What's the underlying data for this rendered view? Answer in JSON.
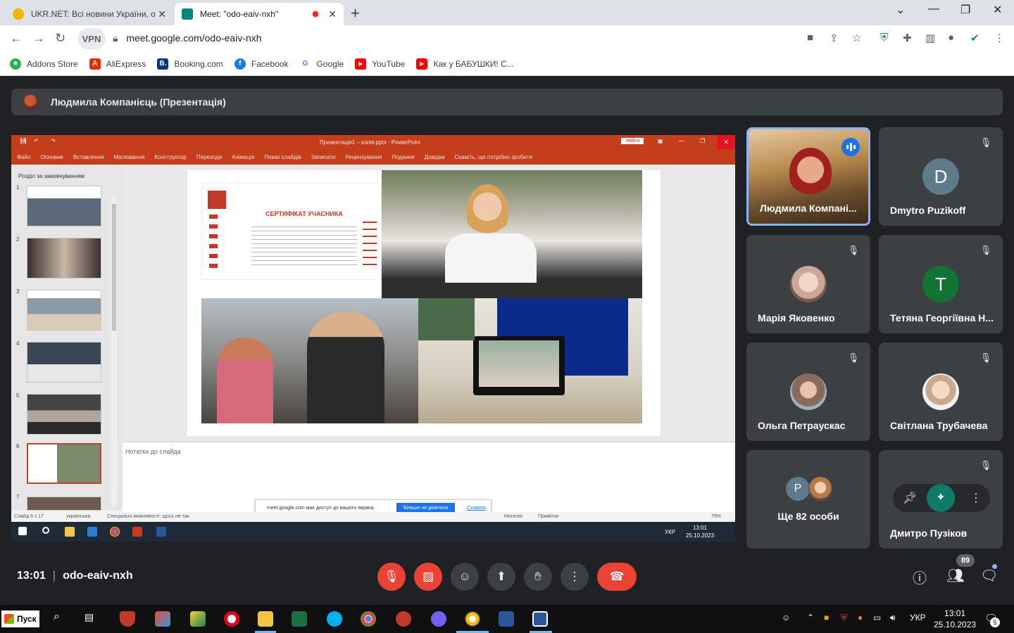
{
  "browser": {
    "tabs": [
      {
        "title": "UKR.NET: Всі новини України, о",
        "active": false,
        "favicon_color": "#f4b400"
      },
      {
        "title": "Meet: \"odo-eaiv-nxh\"",
        "active": true,
        "favicon_color": "#00897b"
      }
    ],
    "url": "meet.google.com/odo-eaiv-nxh",
    "vpn_label": "VPN",
    "bookmarks": [
      {
        "label": "Addons Store",
        "icon_color": "#34a853",
        "icon_char": "★"
      },
      {
        "label": "AliExpress",
        "icon_color": "#e62e04",
        "icon_char": "A"
      },
      {
        "label": "Booking.com",
        "icon_color": "#003580",
        "icon_char": "B."
      },
      {
        "label": "Facebook",
        "icon_color": "#1877f2",
        "icon_char": "f"
      },
      {
        "label": "Google",
        "icon_color": "#ffffff",
        "icon_char": "G"
      },
      {
        "label": "YouTube",
        "icon_color": "#ff0000",
        "icon_char": "▶"
      },
      {
        "label": "Как у БАБУШКИ! С...",
        "icon_color": "#ff0000",
        "icon_char": "▶"
      }
    ]
  },
  "meet": {
    "presenter_label": "Людмила Компанієць (Презентація)",
    "time": "13:01",
    "meeting_code": "odo-eaiv-nxh",
    "participant_count": "89",
    "participants": [
      {
        "name": "Людмила Компані...",
        "type": "video",
        "speaking": true
      },
      {
        "name": "Dmytro Puzikoff",
        "type": "letter",
        "letter": "D",
        "color": "#5f7a8a",
        "muted": true
      },
      {
        "name": "Марія Яковенко",
        "type": "photo",
        "color": "#c9a89a",
        "muted": true
      },
      {
        "name": "Тетяна Георгіївна Н...",
        "type": "letter",
        "letter": "T",
        "color": "#137333",
        "muted": true
      },
      {
        "name": "Ольга Петраускас",
        "type": "photo",
        "color": "#b08a7a",
        "muted": true
      },
      {
        "name": "Світлана Трубачева",
        "type": "photo",
        "color": "#e0c7b5",
        "muted": true
      },
      {
        "name": "Ще 82 особи",
        "type": "more",
        "letter": "P"
      },
      {
        "name": "Дмитро Пузіков",
        "type": "pinned",
        "muted": true
      }
    ],
    "accent": "#8ab4f8",
    "end_call_color": "#ea4335"
  },
  "ppt": {
    "window_title": "Презентація1 – копія.pptx  -  PowerPoint",
    "login": "Увійти",
    "ribbon": [
      "Файл",
      "Основне",
      "Вставлення",
      "Малювання",
      "Конструктор",
      "Переходи",
      "Анімація",
      "Показ слайдів",
      "Записати",
      "Рецензування",
      "Подання",
      "Довідка",
      "Скажіть, що потрібно зробити"
    ],
    "section": "Розділ за замовчуванням",
    "thumb_numbers": [
      "1",
      "2",
      "3",
      "4",
      "5",
      "6",
      "7"
    ],
    "notes_placeholder": "Нотатки до слайда",
    "certificate_title": "СЕРТИФІКАТ УЧАСНИКА",
    "status": {
      "slide": "Слайд 6 з 17",
      "lang": "українська",
      "access": "Спеціальні можливості: щось не так",
      "notes": "Нотатки",
      "comments": "Примітки",
      "zoom": "79%"
    },
    "share_notice": {
      "text": "meet.google.com має доступ до вашого екрана.",
      "stop": "Більше не ділитися",
      "hide": "Сховати"
    },
    "inner_clock": {
      "time": "13:01",
      "date": "25.10.2023"
    },
    "inner_lang": "УКР"
  },
  "taskbar": {
    "start": "Пуск",
    "lang": "УКР",
    "time": "13:01",
    "date": "25.10.2023",
    "notifications": "5"
  }
}
